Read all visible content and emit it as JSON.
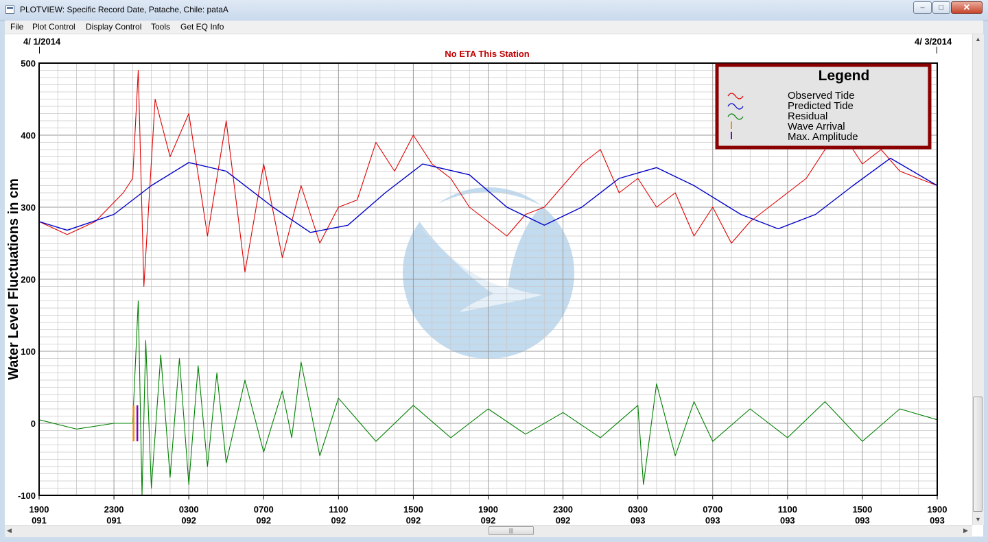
{
  "window": {
    "title": "PLOTVIEW: Specific Record Date, Patache, Chile: pataA",
    "minimize_label": "–",
    "maximize_label": "□",
    "close_label": "✕"
  },
  "menu": {
    "items": [
      {
        "label": "File"
      },
      {
        "label": "Plot Control"
      },
      {
        "label": "Display Control"
      },
      {
        "label": "Tools"
      },
      {
        "label": "Get EQ Info"
      }
    ]
  },
  "plot": {
    "start_date": "4/ 1/2014",
    "end_date": "4/ 3/2014",
    "eta_message": "No ETA This Station",
    "colors": {
      "observed": "#e00000",
      "predicted": "#0000c8",
      "residual": "#008000",
      "wave_arrival": "#ff8c00",
      "max_amplitude": "#8000c0",
      "legend_border": "#8b0000",
      "grid": "#a0a0a0"
    }
  },
  "chart_data": {
    "type": "line",
    "title": "No ETA This Station",
    "xlabel": "",
    "ylabel": "Water Level Fluctuations in cm",
    "ylim": [
      -100,
      500
    ],
    "y_ticks": [
      "500",
      "400",
      "300",
      "200",
      "100",
      "0",
      "-100"
    ],
    "x_ticks": [
      {
        "time": "1900",
        "day": "091"
      },
      {
        "time": "2300",
        "day": "091"
      },
      {
        "time": "0300",
        "day": "092"
      },
      {
        "time": "0700",
        "day": "092"
      },
      {
        "time": "1100",
        "day": "092"
      },
      {
        "time": "1500",
        "day": "092"
      },
      {
        "time": "1900",
        "day": "092"
      },
      {
        "time": "2300",
        "day": "092"
      },
      {
        "time": "0300",
        "day": "093"
      },
      {
        "time": "0700",
        "day": "093"
      },
      {
        "time": "1100",
        "day": "093"
      },
      {
        "time": "1500",
        "day": "093"
      },
      {
        "time": "1900",
        "day": "093"
      }
    ],
    "series": [
      {
        "name": "Predicted Tide",
        "x_hours": [
          0,
          1.5,
          4,
          6,
          8,
          10,
          12.5,
          14.5,
          16.5,
          18.5,
          20.5,
          23,
          25,
          27,
          29,
          31,
          33,
          35,
          37.5,
          39.5,
          41.5,
          43.5,
          45.5,
          48
        ],
        "values": [
          280,
          268,
          290,
          330,
          362,
          350,
          300,
          265,
          275,
          320,
          360,
          345,
          300,
          275,
          300,
          340,
          355,
          330,
          290,
          270,
          290,
          330,
          368,
          330
        ]
      },
      {
        "name": "Observed Tide",
        "x_hours": [
          0,
          1.5,
          3,
          4.5,
          5,
          5.3,
          5.6,
          6.2,
          7,
          8,
          9,
          10,
          11,
          12,
          13,
          14,
          15,
          16,
          17,
          18,
          19,
          20,
          21,
          22,
          23,
          24,
          25,
          26,
          27,
          28,
          29,
          30,
          31,
          32,
          33,
          34,
          35,
          36,
          37,
          38,
          39,
          40,
          41,
          42,
          43,
          44,
          45,
          46,
          47,
          48
        ],
        "values": [
          280,
          262,
          280,
          320,
          340,
          490,
          190,
          450,
          370,
          430,
          260,
          420,
          210,
          360,
          230,
          330,
          250,
          300,
          310,
          390,
          350,
          400,
          360,
          340,
          300,
          280,
          260,
          290,
          300,
          330,
          360,
          380,
          320,
          340,
          300,
          320,
          260,
          300,
          250,
          280,
          300,
          320,
          340,
          380,
          400,
          360,
          380,
          350,
          340,
          330
        ]
      },
      {
        "name": "Residual",
        "x_hours": [
          0,
          2,
          4,
          5,
          5.3,
          5.5,
          5.7,
          6,
          6.5,
          7,
          7.5,
          8,
          8.5,
          9,
          9.5,
          10,
          11,
          12,
          13,
          13.5,
          14,
          15,
          16,
          18,
          20,
          22,
          24,
          26,
          28,
          30,
          32,
          32.3,
          33,
          34,
          35,
          36,
          38,
          40,
          42,
          44,
          46,
          48
        ],
        "values": [
          5,
          -8,
          0,
          0,
          170,
          -100,
          115,
          -90,
          95,
          -75,
          90,
          -85,
          80,
          -60,
          70,
          -55,
          60,
          -40,
          45,
          -20,
          85,
          -45,
          35,
          -25,
          25,
          -20,
          20,
          -15,
          15,
          -20,
          25,
          -85,
          55,
          -45,
          30,
          -25,
          20,
          -20,
          30,
          -25,
          20,
          5
        ]
      }
    ],
    "legend": {
      "title": "Legend",
      "position": "top-right",
      "entries": [
        "Observed Tide",
        "Predicted Tide",
        "Residual",
        "Wave Arrival",
        "Max. Amplitude"
      ]
    },
    "markers": [
      {
        "name": "Wave Arrival",
        "x_hours": 5.05
      },
      {
        "name": "Max. Amplitude",
        "x_hours": 5.25
      }
    ],
    "grid": true,
    "watermark": "NOAA"
  }
}
